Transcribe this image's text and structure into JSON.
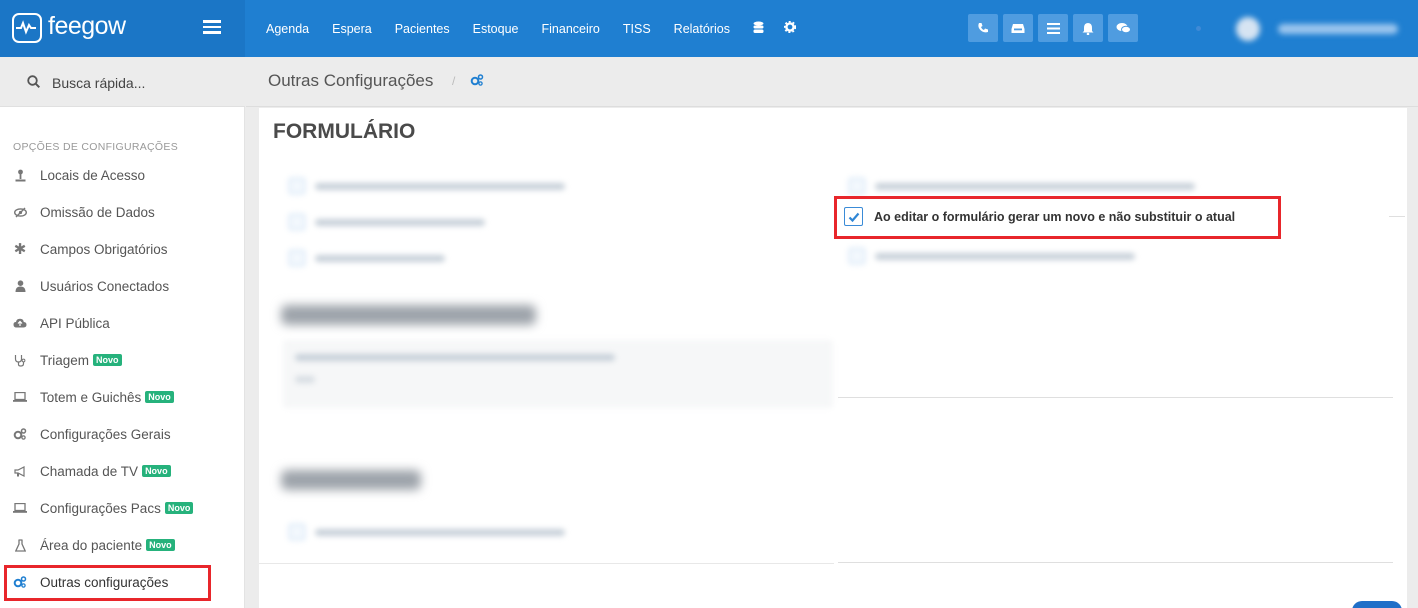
{
  "brand": {
    "name": "feegow"
  },
  "nav": {
    "items": [
      "Agenda",
      "Espera",
      "Pacientes",
      "Estoque",
      "Financeiro",
      "TISS",
      "Relatórios"
    ],
    "icons": [
      "database-icon",
      "gear-icon"
    ]
  },
  "toolbar": {
    "buttons": [
      "phone-icon",
      "inbox-icon",
      "list-icon",
      "bell-icon",
      "chat-icon"
    ]
  },
  "search": {
    "label": "Busca rápida..."
  },
  "sidebar": {
    "header": "OPÇÕES DE CONFIGURAÇÕES",
    "items": [
      {
        "label": "Locais de Acesso",
        "icon": "location-icon"
      },
      {
        "label": "Omissão de Dados",
        "icon": "eye-slash-icon"
      },
      {
        "label": "Campos Obrigatórios",
        "icon": "asterisk-icon"
      },
      {
        "label": "Usuários Conectados",
        "icon": "user-icon"
      },
      {
        "label": "API Pública",
        "icon": "cloud-icon"
      },
      {
        "label": "Triagem",
        "icon": "stethoscope-icon",
        "badge": "Novo"
      },
      {
        "label": "Totem e Guichês",
        "icon": "laptop-icon",
        "badge": "Novo"
      },
      {
        "label": "Configurações Gerais",
        "icon": "gears-icon"
      },
      {
        "label": "Chamada de TV",
        "icon": "bullhorn-icon",
        "badge": "Novo"
      },
      {
        "label": "Configurações Pacs",
        "icon": "laptop-icon",
        "badge": "Novo"
      },
      {
        "label": "Área do paciente",
        "icon": "flask-icon",
        "badge": "Novo"
      },
      {
        "label": "Outras configurações",
        "icon": "gears-icon"
      }
    ]
  },
  "breadcrumb": {
    "title": "Outras Configurações",
    "separator": "/"
  },
  "main": {
    "section_title": "FORMULÁRIO",
    "option": {
      "label": "Ao editar o formulário gerar um novo e não substituir o atual",
      "checked": true
    }
  },
  "colors": {
    "accent": "#1f7fd1",
    "highlight": "#e8262b",
    "badge": "#26b27c"
  }
}
